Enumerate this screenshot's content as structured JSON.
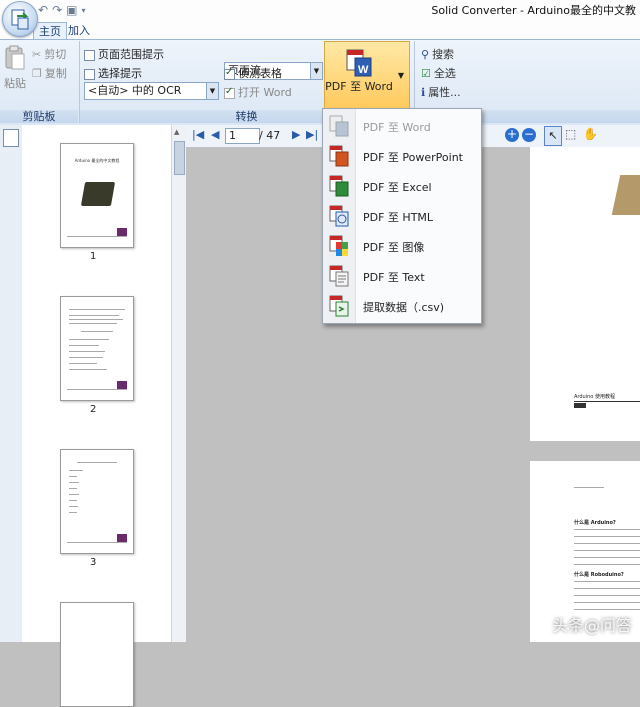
{
  "window": {
    "title": "Solid Converter - Arduino最全的中文教"
  },
  "tabs": [
    {
      "label": "主页"
    },
    {
      "label": "加入"
    }
  ],
  "ribbon": {
    "clipboard": {
      "paste": "粘贴",
      "cut": "剪切",
      "copy": "复制",
      "group_label": "剪贴板"
    },
    "convert": {
      "page_range_hint": "页面范围提示",
      "selection_hint": "选择提示",
      "ocr_value": "<自动> 中的 OCR",
      "layout_value": "页面流",
      "detect_tables": "侦测表格",
      "open_word": "打开 Word",
      "pdf_word_button": "PDF 至 Word",
      "group_label": "转换"
    },
    "tools": {
      "search": "搜索",
      "select_all": "全选",
      "properties": "属性..."
    }
  },
  "navigation": {
    "page_current": "1",
    "page_total": "/ 47"
  },
  "thumbnails": [
    {
      "number": "1"
    },
    {
      "number": "2"
    },
    {
      "number": "3"
    }
  ],
  "thumb_page1_title": "Arduino 最全的中文教程",
  "dropdown_menu": [
    {
      "label": "PDF 至 Word",
      "icon": "word-doc-icon",
      "enabled": false
    },
    {
      "label": "PDF 至 PowerPoint",
      "icon": "powerpoint-doc-icon",
      "enabled": true
    },
    {
      "label": "PDF 至 Excel",
      "icon": "excel-doc-icon",
      "enabled": true
    },
    {
      "label": "PDF 至 HTML",
      "icon": "html-doc-icon",
      "enabled": true
    },
    {
      "label": "PDF 至 图像",
      "icon": "image-doc-icon",
      "enabled": true
    },
    {
      "label": "PDF 至 Text",
      "icon": "text-doc-icon",
      "enabled": true
    },
    {
      "label": "提取数据（.csv)",
      "icon": "csv-data-icon",
      "enabled": true
    }
  ],
  "doc_preview": {
    "caption": "Arduino 使用教程",
    "heading1": "什么是 Arduino?",
    "heading2": "什么是 Roboduino?"
  },
  "watermark": "头条@问答"
}
